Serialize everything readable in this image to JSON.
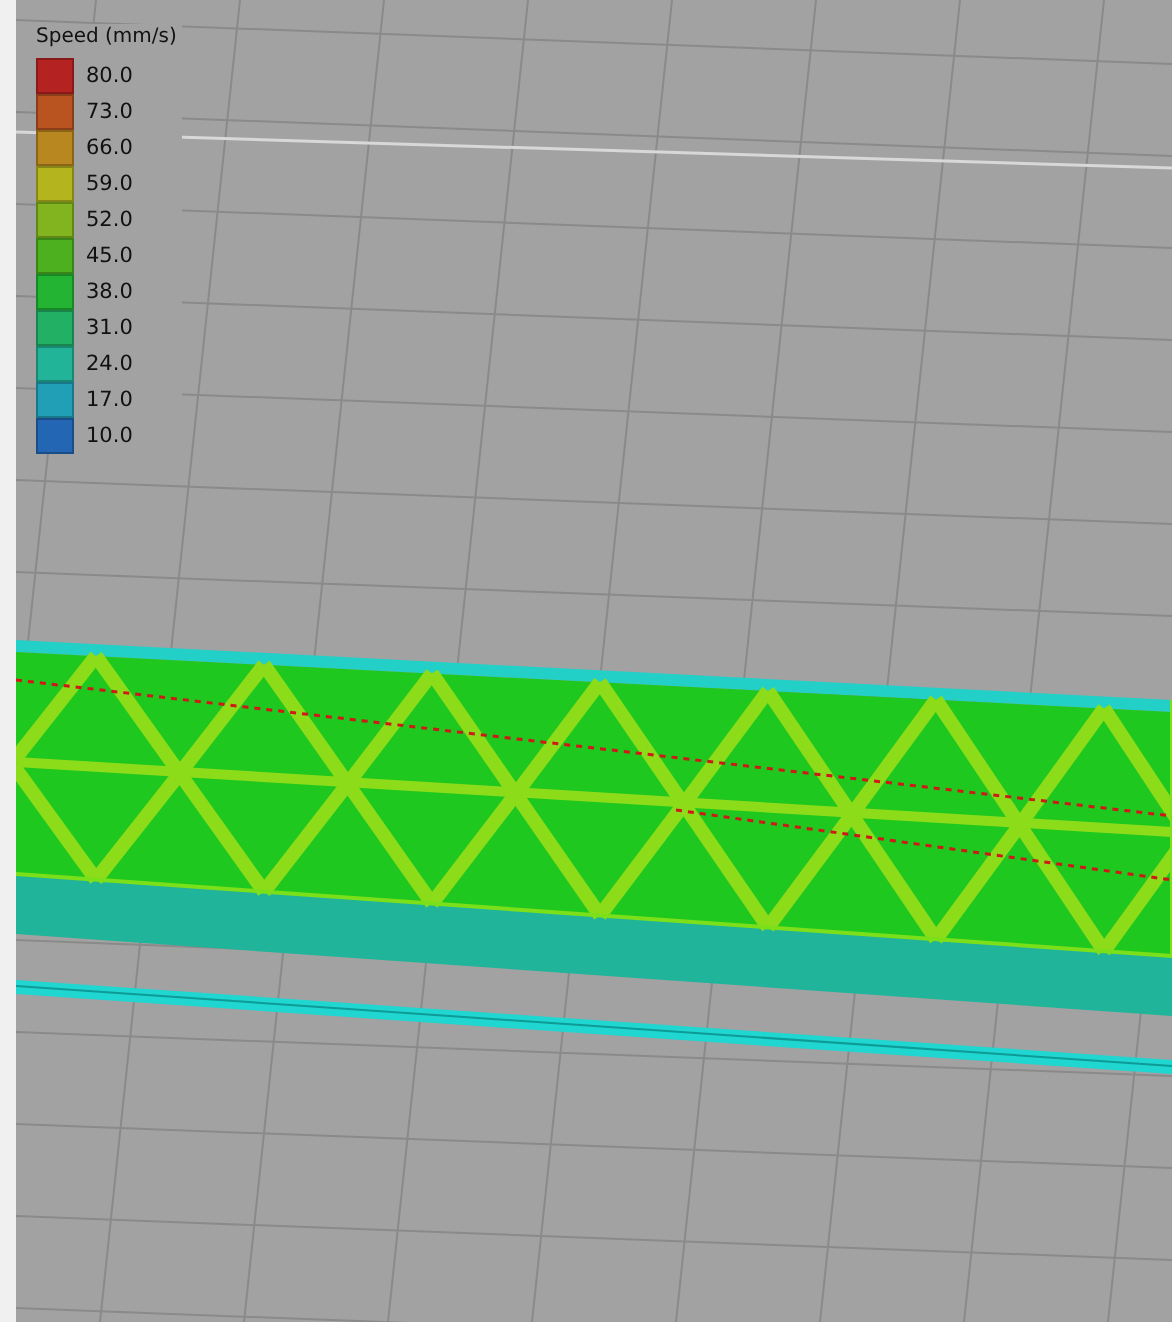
{
  "legend": {
    "title": "Speed (mm/s)",
    "entries": [
      {
        "label": "80.0",
        "color": "#b42222"
      },
      {
        "label": "73.0",
        "color": "#b9531f"
      },
      {
        "label": "66.0",
        "color": "#b9871f"
      },
      {
        "label": "59.0",
        "color": "#b4b41f"
      },
      {
        "label": "52.0",
        "color": "#82b41f"
      },
      {
        "label": "45.0",
        "color": "#4cb01f"
      },
      {
        "label": "38.0",
        "color": "#22b432"
      },
      {
        "label": "31.0",
        "color": "#22b064"
      },
      {
        "label": "24.0",
        "color": "#22b499"
      },
      {
        "label": "17.0",
        "color": "#209fb6"
      },
      {
        "label": "10.0",
        "color": "#2366b4"
      }
    ]
  }
}
